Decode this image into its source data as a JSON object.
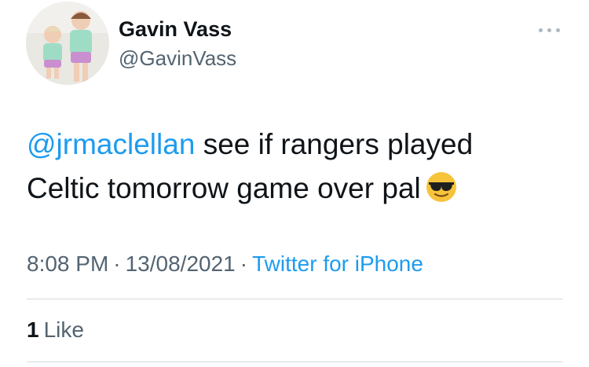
{
  "author": {
    "display_name": "Gavin Vass",
    "handle": "@GavinVass"
  },
  "tweet": {
    "mention": "@jrmaclellan",
    "text_line1": "see if rangers played",
    "text_line2": "Celtic tomorrow game over pal",
    "emoji": "smiling-face-with-sunglasses"
  },
  "meta": {
    "time": "8:08 PM",
    "separator": "·",
    "date": "13/08/2021",
    "source": "Twitter for iPhone"
  },
  "engagement": {
    "like_count": "1",
    "like_label": "Like"
  },
  "colors": {
    "link": "#1d9bf0",
    "secondary_text": "#536471",
    "divider": "#d4d9dd"
  }
}
